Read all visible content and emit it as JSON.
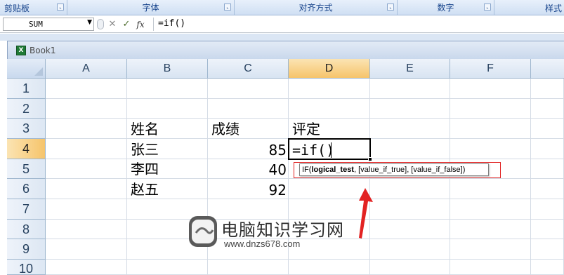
{
  "ribbon": {
    "groups": [
      {
        "label": "剪贴板"
      },
      {
        "label": "字体"
      },
      {
        "label": "对齐方式"
      },
      {
        "label": "数字"
      },
      {
        "label": "样式"
      }
    ]
  },
  "formula_bar": {
    "name_box": "SUM",
    "cancel_icon": "✕",
    "enter_icon": "✓",
    "fx_label": "fx",
    "formula": "=if()"
  },
  "workbook": {
    "title": "Book1"
  },
  "sheet": {
    "columns": [
      "A",
      "B",
      "C",
      "D",
      "E",
      "F"
    ],
    "rows": [
      "1",
      "2",
      "3",
      "4",
      "5",
      "6",
      "7",
      "8",
      "9",
      "10"
    ],
    "active_column": "D",
    "active_row": "4",
    "cells": {
      "B3": "姓名",
      "C3": "成绩",
      "D3": "评定",
      "B4": "张三",
      "C4": "85",
      "D4": "=if()",
      "B5": "李四",
      "C5": "40",
      "B6": "赵五",
      "C6": "92"
    }
  },
  "tooltip": {
    "prefix": "IF(",
    "bold_arg": "logical_test",
    "rest": ", [value_if_true], [value_if_false])"
  },
  "watermark": {
    "title": "电脑知识学习网",
    "url": "www.dnzs678.com"
  },
  "colors": {
    "active_header": "#f6c46b",
    "highlight_box": "#e02020",
    "ribbon_text": "#15428b"
  }
}
